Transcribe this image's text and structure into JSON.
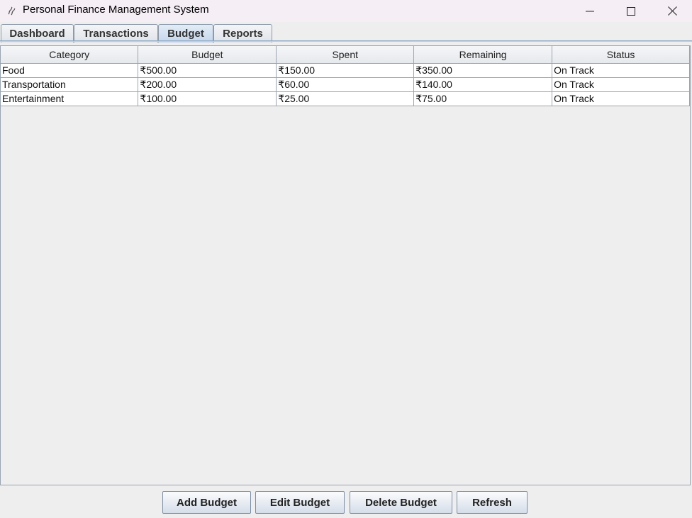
{
  "window": {
    "title": "Personal Finance Management System"
  },
  "tabs": [
    {
      "label": "Dashboard",
      "active": false
    },
    {
      "label": "Transactions",
      "active": false
    },
    {
      "label": "Budget",
      "active": true
    },
    {
      "label": "Reports",
      "active": false
    }
  ],
  "table": {
    "headers": [
      "Category",
      "Budget",
      "Spent",
      "Remaining",
      "Status"
    ],
    "rows": [
      [
        "Food",
        "₹500.00",
        "₹150.00",
        "₹350.00",
        "On Track"
      ],
      [
        "Transportation",
        "₹200.00",
        "₹60.00",
        "₹140.00",
        "On Track"
      ],
      [
        "Entertainment",
        "₹100.00",
        "₹25.00",
        "₹75.00",
        "On Track"
      ]
    ]
  },
  "buttons": {
    "add": "Add Budget",
    "edit": "Edit Budget",
    "delete": "Delete Budget",
    "refresh": "Refresh"
  },
  "colors": {
    "active_tab": "#c4d6ec",
    "window_bg": "#eeeeee"
  }
}
